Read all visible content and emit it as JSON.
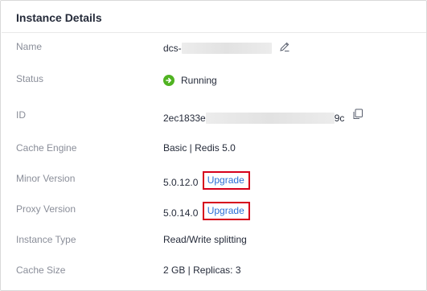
{
  "panel": {
    "title": "Instance Details"
  },
  "fields": {
    "name": {
      "label": "Name",
      "value_prefix": "dcs-"
    },
    "status": {
      "label": "Status",
      "value": "Running"
    },
    "id": {
      "label": "ID",
      "value_prefix": "2ec1833e",
      "value_suffix": "9c"
    },
    "cache_engine": {
      "label": "Cache Engine",
      "value": "Basic | Redis 5.0"
    },
    "minor_version": {
      "label": "Minor Version",
      "value": "5.0.12.0",
      "action": "Upgrade"
    },
    "proxy_version": {
      "label": "Proxy Version",
      "value": "5.0.14.0",
      "action": "Upgrade"
    },
    "instance_type": {
      "label": "Instance Type",
      "value": "Read/Write splitting"
    },
    "cache_size": {
      "label": "Cache Size",
      "value": "2 GB | Replicas: 3"
    }
  },
  "icons": {
    "edit": "pencil-icon",
    "copy": "copy-icon",
    "status": "check-arrow-icon"
  },
  "colors": {
    "status_running": "#50b322",
    "link": "#2b6fd6",
    "highlight_box": "#d6001c",
    "label": "#8a8e99",
    "value": "#252b3a"
  }
}
